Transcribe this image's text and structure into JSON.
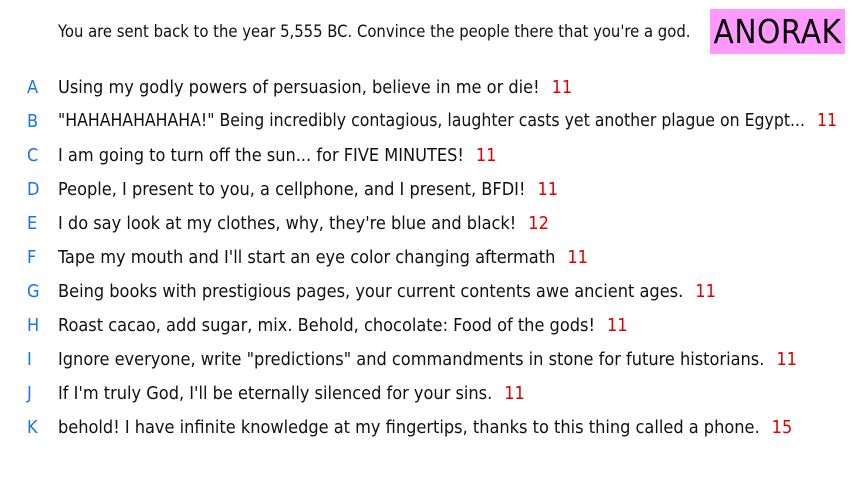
{
  "prompt": "You are sent back to the year 5,555 BC. Convince the people there that you're a god.",
  "badge": "ANORAK",
  "colors": {
    "letter": "#1a73e8",
    "score": "#e00000",
    "badge_bg": "#ff99ff"
  },
  "answers": [
    {
      "letter": "A",
      "text": "Using my godly powers of persuasion, believe in me or die!",
      "score": "11"
    },
    {
      "letter": "B",
      "text": "\"HAHAHAHAHAHA!\" Being incredibly contagious, laughter casts yet another plague on Egypt...",
      "score": "11"
    },
    {
      "letter": "C",
      "text": "I am going to turn off the sun... for FIVE MINUTES!",
      "score": "11"
    },
    {
      "letter": "D",
      "text": "People, I present to you, a cellphone, and I present, BFDI!",
      "score": "11"
    },
    {
      "letter": "E",
      "text": "I do say look at my clothes, why, they're blue and black!",
      "score": "12"
    },
    {
      "letter": "F",
      "text": "Tape my mouth and I'll start an eye color changing aftermath",
      "score": "11"
    },
    {
      "letter": "G",
      "text": "Being books with prestigious pages, your current contents awe ancient ages.",
      "score": "11"
    },
    {
      "letter": "H",
      "text": "Roast cacao, add sugar, mix. Behold, chocolate: Food of the gods!",
      "score": "11"
    },
    {
      "letter": "I",
      "text": "Ignore everyone, write \"predictions\" and commandments in stone for future historians.",
      "score": "11"
    },
    {
      "letter": "J",
      "text": "If I'm truly God, I'll be eternally silenced for your sins.",
      "score": "11"
    },
    {
      "letter": "K",
      "text": "behold! I have infinite knowledge at my fingertips, thanks to this thing called a phone.",
      "score": "15"
    }
  ]
}
